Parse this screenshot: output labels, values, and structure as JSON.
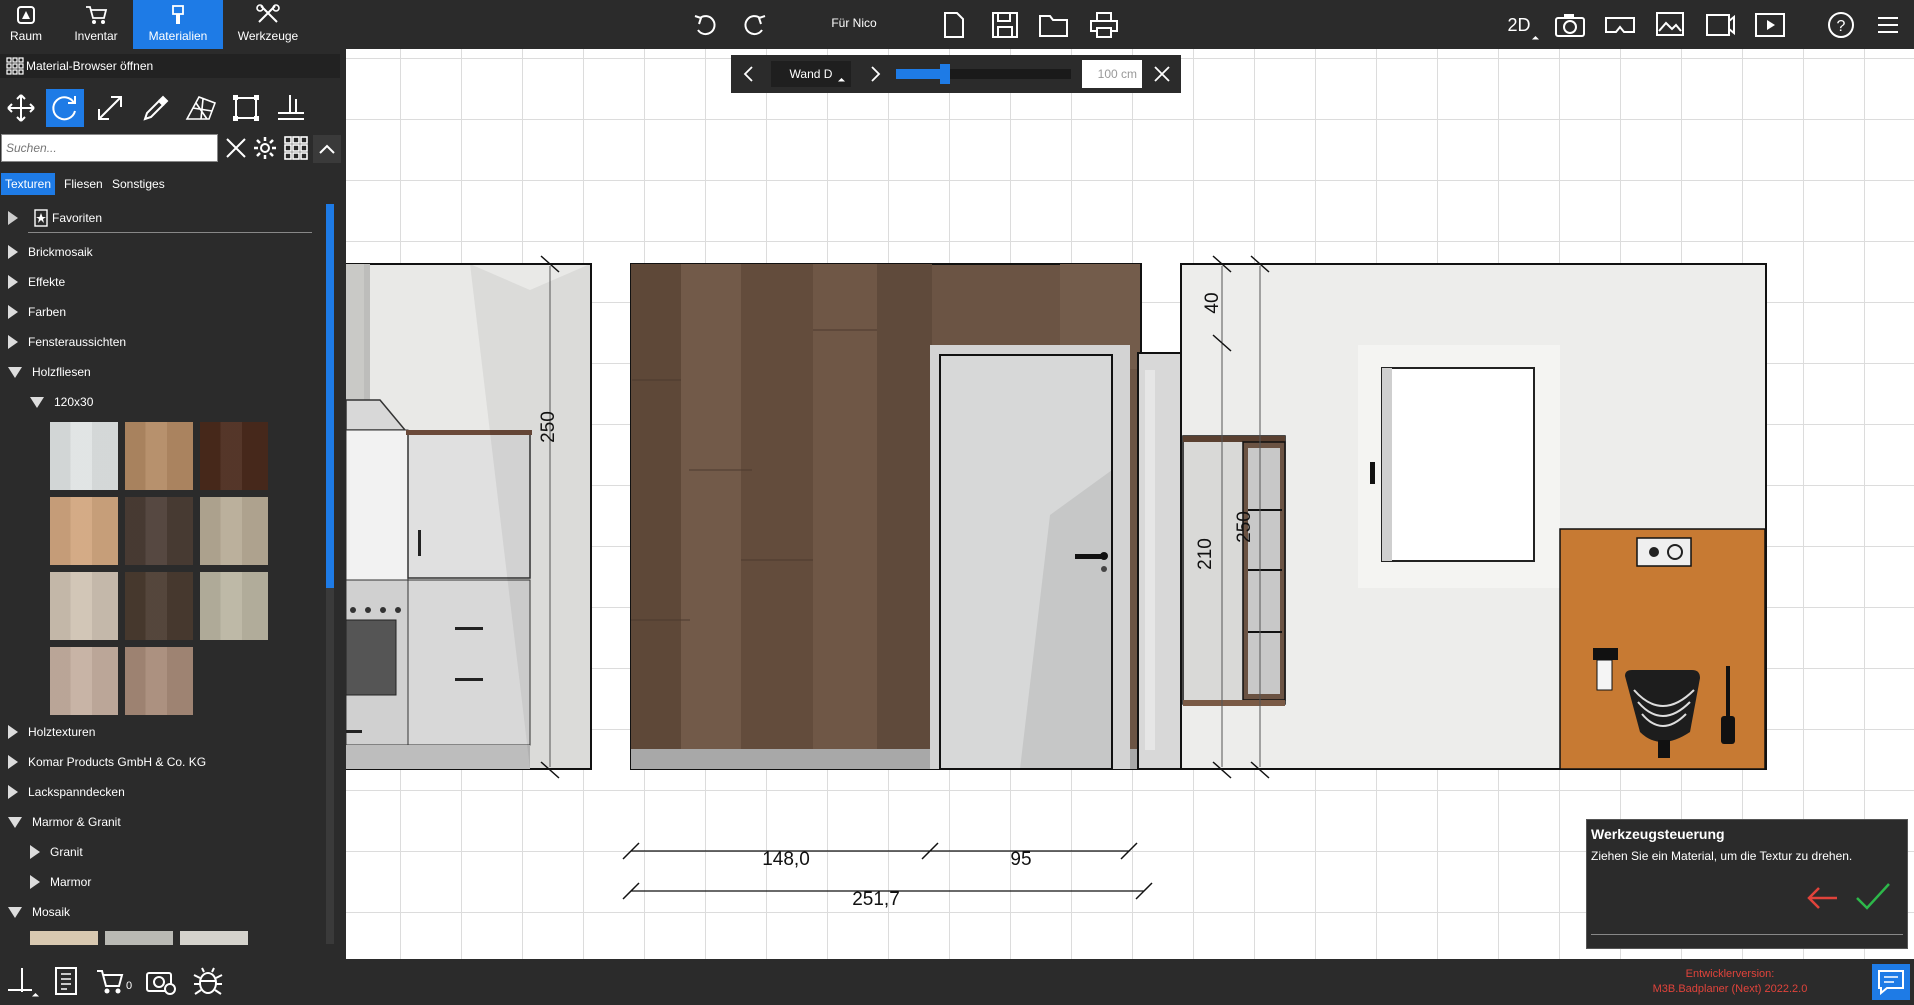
{
  "topbar": {
    "tabs": [
      {
        "label": "Raum",
        "icon": "room-icon"
      },
      {
        "label": "Inventar",
        "icon": "cart-icon"
      },
      {
        "label": "Materialien",
        "icon": "paint-brush-icon"
      },
      {
        "label": "Werkzeuge",
        "icon": "tools-icon"
      }
    ],
    "project_name": "Für Nico",
    "view_mode": "2D"
  },
  "wall_nav": {
    "wall_name": "Wand D",
    "slider_percent": 28,
    "offset_value": "100 cm"
  },
  "sidebar": {
    "browser_title": "Material-Browser öffnen",
    "search_placeholder": "Suchen...",
    "tabs": [
      "Texturen",
      "Fliesen",
      "Sonstiges"
    ],
    "active_tab": "Texturen",
    "tree": [
      {
        "label": "Favoriten",
        "expanded": false
      },
      {
        "label": "Brickmosaik",
        "expanded": false
      },
      {
        "label": "Effekte",
        "expanded": false
      },
      {
        "label": "Farben",
        "expanded": false
      },
      {
        "label": "Fensteraussichten",
        "expanded": false
      },
      {
        "label": "Holzfliesen",
        "expanded": true
      },
      {
        "label": "120x30",
        "expanded": true
      },
      {
        "label": "Holztexturen",
        "expanded": false
      },
      {
        "label": "Komar Products GmbH & Co. KG",
        "expanded": false
      },
      {
        "label": "Lackspanndecken",
        "expanded": false
      },
      {
        "label": "Marmor & Granit",
        "expanded": true
      },
      {
        "label": "Granit",
        "expanded": false
      },
      {
        "label": "Marmor",
        "expanded": false
      },
      {
        "label": "Mosaik",
        "expanded": true
      }
    ],
    "swatch_colors": [
      "#dfe3e3",
      "#b38a64",
      "#4a2a1c",
      "#d1a67f",
      "#4b3d35",
      "#b7ab96",
      "#cfc2b3",
      "#4a3b30",
      "#bab5a2",
      "#c5afa0",
      "#a78a78"
    ],
    "mosaic_colors": [
      "#d8c8b0",
      "#b9b9b4",
      "#d4d2cc"
    ]
  },
  "dimensions": {
    "left_height": "250",
    "right_top": "40",
    "right_height": "250",
    "right_door": "210",
    "bottom_a": "148,0",
    "bottom_b": "95",
    "bottom_total": "251,7"
  },
  "tool_panel": {
    "title": "Werkzeugsteuerung",
    "message": "Ziehen Sie ein Material, um die Textur zu drehen."
  },
  "footer": {
    "version_line1": "Entwicklerversion:",
    "version_line2": "M3B.Badplaner (Next) 2022.2.0",
    "cart_count": "0"
  },
  "colors": {
    "accent": "#1e7be6",
    "version_text": "#e0433b",
    "confirm": "#2db84a",
    "cancel": "#e0433b",
    "wood": "#6b5444",
    "orange_tile": "#c77a33"
  }
}
